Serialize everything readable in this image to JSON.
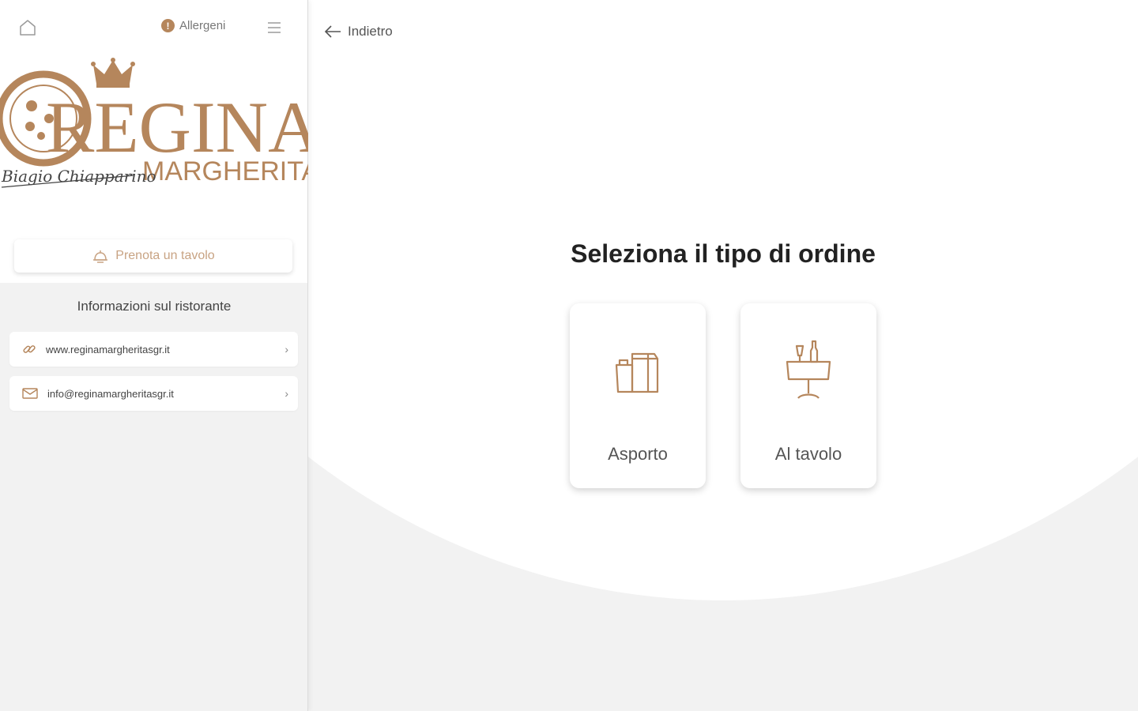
{
  "sidebar": {
    "home_icon": "home-icon",
    "allergeni": {
      "badge": "!",
      "label": "Allergeni"
    },
    "menu_icon": "hamburger-menu-icon",
    "logo": {
      "brand": "REGINA",
      "sub": "MARGHERITA",
      "signature": "Biagio Chiapparino"
    },
    "prenota_label": "Prenota un tavolo",
    "info_title": "Informazioni sul ristorante",
    "links": [
      {
        "icon": "link-icon",
        "text": "www.reginamargheritasgr.it"
      },
      {
        "icon": "mail-icon",
        "text": "info@reginamargheritasgr.it"
      }
    ],
    "chevron": "›"
  },
  "main": {
    "back_label": "Indietro",
    "heading": "Seleziona il tipo di ordine",
    "options": [
      {
        "label": "Asporto",
        "icon": "takeaway-bag-icon"
      },
      {
        "label": "Al tavolo",
        "icon": "dining-table-icon"
      }
    ]
  },
  "colors": {
    "accent": "#b5865c",
    "accent_light": "#c8a383",
    "background": "#f2f2f2",
    "card": "#ffffff"
  }
}
